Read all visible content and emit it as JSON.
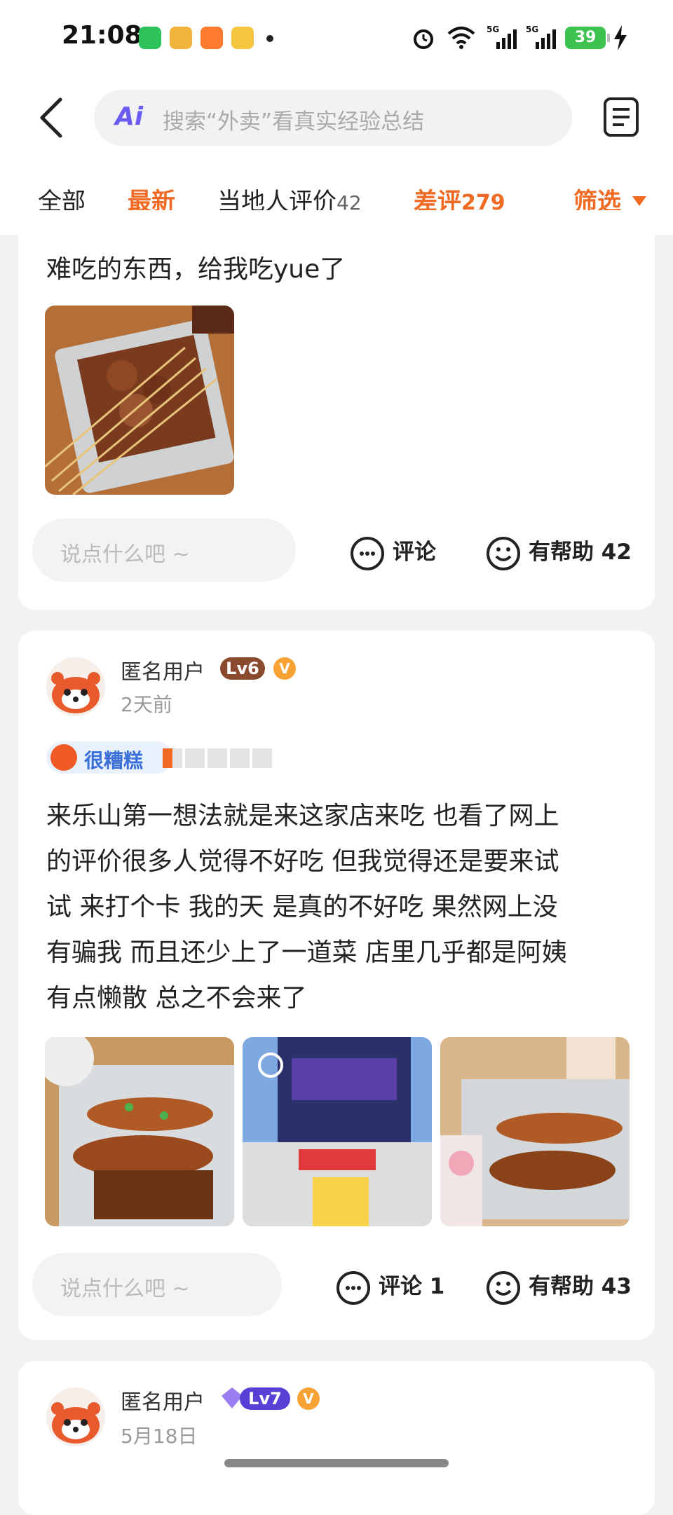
{
  "status_bar": {
    "time": "21:08",
    "battery": "39"
  },
  "header": {
    "search_ai_label": "Ai",
    "search_placeholder": "搜索“外卖”看真实经验总结"
  },
  "tabs": [
    {
      "label": "全部"
    },
    {
      "label": "最新"
    },
    {
      "label": "当地人评价",
      "count": "42"
    },
    {
      "label": "差评",
      "count": "279"
    },
    {
      "label": "筛选"
    }
  ],
  "reviews": [
    {
      "text": "难吃的东西，给我吃yue了",
      "comment_placeholder": "说点什么吧 ~",
      "comment_label": "评论",
      "helpful_label": "有帮助 42"
    },
    {
      "username": "匿名用户",
      "level": "Lv6",
      "time": "2天前",
      "rating_label": "很糟糕",
      "stars": 0.5,
      "text_lines": [
        "来乐山第一想法就是来这家店来吃 也看了网上",
        "的评价很多人觉得不好吃 但我觉得还是要来试",
        "试 来打个卡 我的天 是真的不好吃 果然网上没",
        "有骗我 而且还少上了一道菜 店里几乎都是阿姨",
        "有点懒散 总之不会来了"
      ],
      "comment_placeholder": "说点什么吧 ~",
      "comment_label": "评论 1",
      "helpful_label": "有帮助 43"
    },
    {
      "username": "匿名用户",
      "level": "Lv7",
      "time": "5月18日"
    }
  ],
  "colors": {
    "accent": "#f06a23",
    "rating_blue": "#3a6fd8",
    "lv6": "#8a4a2e",
    "lv7": "#5a3fd6"
  }
}
